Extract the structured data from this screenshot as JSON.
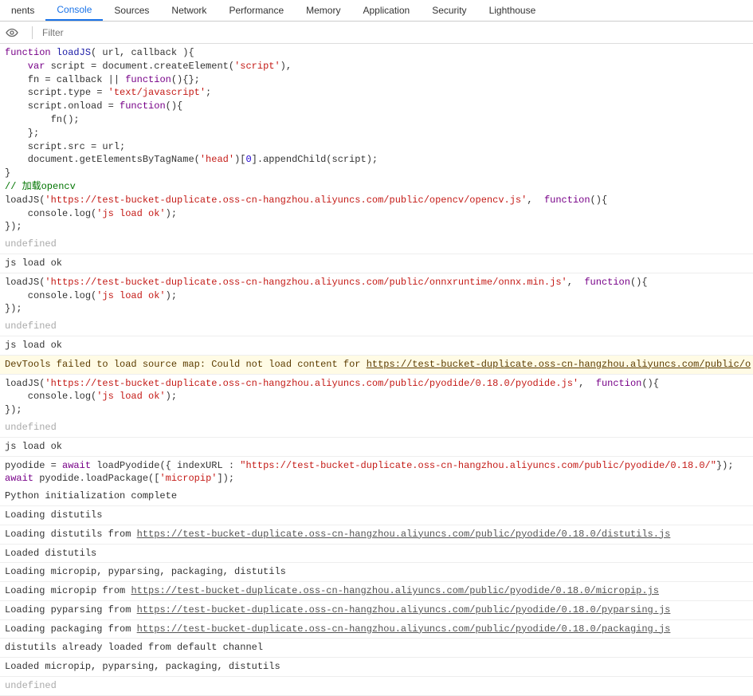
{
  "tabs": [
    "nents",
    "Console",
    "Sources",
    "Network",
    "Performance",
    "Memory",
    "Application",
    "Security",
    "Lighthouse"
  ],
  "active_tab": "Console",
  "toolbar": {
    "filter_placeholder": "Filter"
  },
  "code": {
    "block1": {
      "l1a": "function",
      "l1b": " loadJS",
      "l1c": "( url, callback ){",
      "l2a": "    var",
      "l2b": " script = document.createElement(",
      "l2c": "'script'",
      "l2d": "),",
      "l3a": "    fn = callback || ",
      "l3b": "function",
      "l3c": "(){};",
      "l4a": "    script.type = ",
      "l4b": "'text/javascript'",
      "l4c": ";",
      "l5a": "    script.onload = ",
      "l5b": "function",
      "l5c": "(){",
      "l6": "        fn();",
      "l7": "    };",
      "l8": "    script.src = url;",
      "l9a": "    document.getElementsByTagName(",
      "l9b": "'head'",
      "l9c": ")[",
      "l9d": "0",
      "l9e": "].appendChild(script);",
      "l10": "}",
      "l11": "// 加载opencv",
      "l12a": "loadJS(",
      "l12b": "'https://test-bucket-duplicate.oss-cn-hangzhou.aliyuncs.com/public/opencv/opencv.js'",
      "l12c": ",  ",
      "l12d": "function",
      "l12e": "(){",
      "l13a": "    console.log(",
      "l13b": "'js load ok'",
      "l13c": ");",
      "l14": "});"
    },
    "block2": {
      "l1a": "loadJS(",
      "l1b": "'https://test-bucket-duplicate.oss-cn-hangzhou.aliyuncs.com/public/onnxruntime/onnx.min.js'",
      "l1c": ",  ",
      "l1d": "function",
      "l1e": "(){",
      "l2a": "    console.log(",
      "l2b": "'js load ok'",
      "l2c": ");",
      "l3": "});"
    },
    "block3": {
      "l1a": "loadJS(",
      "l1b": "'https://test-bucket-duplicate.oss-cn-hangzhou.aliyuncs.com/public/pyodide/0.18.0/pyodide.js'",
      "l1c": ",  ",
      "l1d": "function",
      "l1e": "(){",
      "l2a": "    console.log(",
      "l2b": "'js load ok'",
      "l2c": ");",
      "l3": "});"
    },
    "block4": {
      "l1a": "pyodide = ",
      "l1b": "await",
      "l1c": " loadPyodide({ indexURL : ",
      "l1d": "\"https://test-bucket-duplicate.oss-cn-hangzhou.aliyuncs.com/public/pyodide/0.18.0/\"",
      "l1e": "});",
      "l2a": "await",
      "l2b": " pyodide.loadPackage([",
      "l2c": "'micropip'",
      "l2d": "]);"
    }
  },
  "out": {
    "undefined": "undefined",
    "jsloadok": "js load ok",
    "warn_pre": "DevTools failed to load source map: Could not load content for ",
    "warn_link": "https://test-bucket-duplicate.oss-cn-hangzhou.aliyuncs.com/public/o",
    "py_init": "Python initialization complete",
    "load_distutils": "Loading distutils",
    "load_distutils_from": "Loading distutils from ",
    "url_distutils": "https://test-bucket-duplicate.oss-cn-hangzhou.aliyuncs.com/public/pyodide/0.18.0/distutils.js",
    "loaded_distutils": "Loaded distutils",
    "loading_mppp": "Loading micropip, pyparsing, packaging, distutils",
    "load_micropip_from": "Loading micropip from ",
    "url_micropip": "https://test-bucket-duplicate.oss-cn-hangzhou.aliyuncs.com/public/pyodide/0.18.0/micropip.js",
    "load_pyparsing_from": "Loading pyparsing from ",
    "url_pyparsing": "https://test-bucket-duplicate.oss-cn-hangzhou.aliyuncs.com/public/pyodide/0.18.0/pyparsing.js",
    "load_packaging_from": "Loading packaging from ",
    "url_packaging": "https://test-bucket-duplicate.oss-cn-hangzhou.aliyuncs.com/public/pyodide/0.18.0/packaging.js",
    "distutils_already": "distutils already loaded from default channel",
    "loaded_mppp": "Loaded micropip, pyparsing, packaging, distutils"
  }
}
